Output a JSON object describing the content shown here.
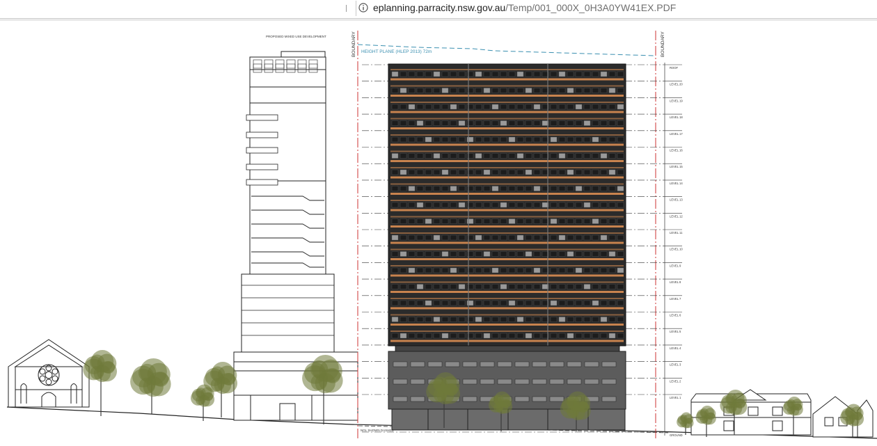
{
  "browser": {
    "url_host": "eplanning.parracity.nsw.gov.au",
    "url_path": "/Temp/001_000X_0H3A0YW41EX.PDF"
  },
  "drawing": {
    "boundary_label": "BOUNDARY",
    "height_plane_label": "HEIGHT PLANE (HLEP 2013) 72m",
    "neighbour_label": "PROPOSED MIXED USE DEVELOPMENT",
    "ground_note": "NGL SHOWN DASHED",
    "level_labels": [
      "ROOF",
      "LEVEL 20",
      "LEVEL 19",
      "LEVEL 18",
      "LEVEL 17",
      "LEVEL 16",
      "LEVEL 15",
      "LEVEL 14",
      "LEVEL 13",
      "LEVEL 12",
      "LEVEL 11",
      "LEVEL 10",
      "LEVEL 9",
      "LEVEL 8",
      "LEVEL 7",
      "LEVEL 6",
      "LEVEL 5",
      "LEVEL 4",
      "LEVEL 3",
      "LEVEL 2",
      "LEVEL 1",
      "GROUND"
    ],
    "colors": {
      "boundary": "#cc3333",
      "height_plane": "#3a8fb0",
      "facade_dark": "#2b2b2b",
      "facade_orange": "#c8834e",
      "podium": "#5a5a5a",
      "tree": "#6f7a3a"
    }
  }
}
